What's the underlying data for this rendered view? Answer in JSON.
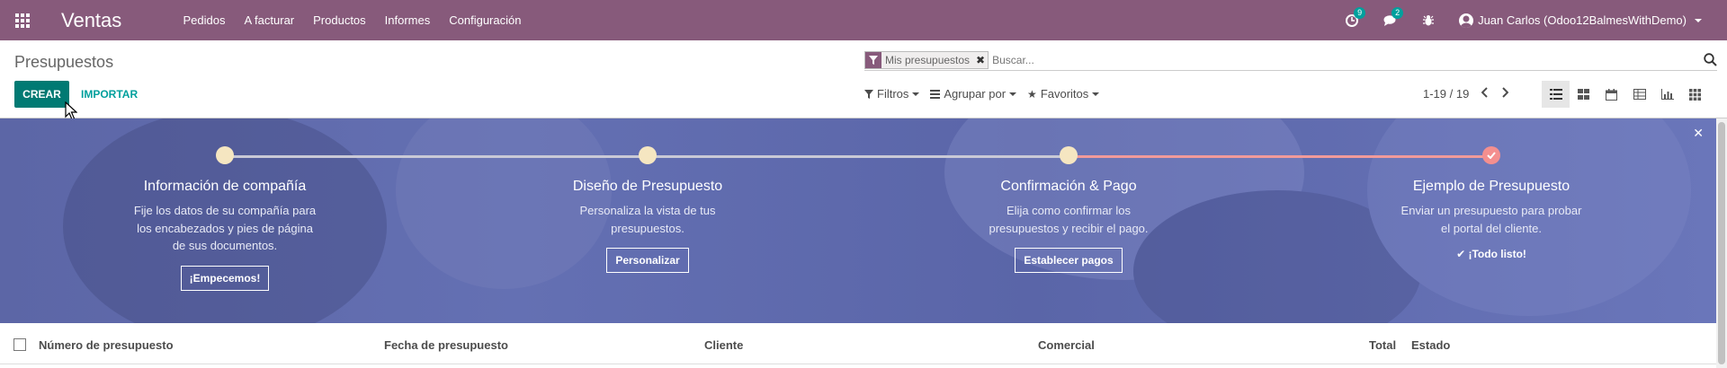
{
  "navbar": {
    "app_title": "Ventas",
    "menu": [
      "Pedidos",
      "A facturar",
      "Productos",
      "Informes",
      "Configuración"
    ],
    "activity_badge": "9",
    "messages_badge": "2",
    "user_name": "Juan Carlos (Odoo12BalmesWithDemo)",
    "color": "#875a7b"
  },
  "control_panel": {
    "breadcrumb": "Presupuestos",
    "create_label": "CREAR",
    "import_label": "IMPORTAR",
    "search": {
      "facet": "Mis presupuestos",
      "placeholder": "Buscar..."
    },
    "filters_label": "Filtros",
    "groupby_label": "Agrupar por",
    "favorites_label": "Favoritos",
    "pager": "1-19 / 19"
  },
  "onboarding": {
    "steps": [
      {
        "title": "Información de compañía",
        "desc": [
          "Fije los datos de su compañía para",
          "los encabezados y pies de página",
          "de sus documentos."
        ],
        "button": "¡Empecemos!"
      },
      {
        "title": "Diseño de Presupuesto",
        "desc": [
          "Personaliza la vista de tus",
          "presupuestos."
        ],
        "button": "Personalizar"
      },
      {
        "title": "Confirmación & Pago",
        "desc": [
          "Elija como confirmar los",
          "presupuestos y recibir el pago."
        ],
        "button": "Establecer pagos"
      },
      {
        "title": "Ejemplo de Presupuesto",
        "desc": [
          "Enviar un presupuesto para probar",
          "el portal del cliente."
        ],
        "done_label": "¡Todo listo!"
      }
    ]
  },
  "table": {
    "columns": [
      "Número de presupuesto",
      "Fecha de presupuesto",
      "Cliente",
      "Comercial",
      "Total",
      "Estado"
    ]
  }
}
